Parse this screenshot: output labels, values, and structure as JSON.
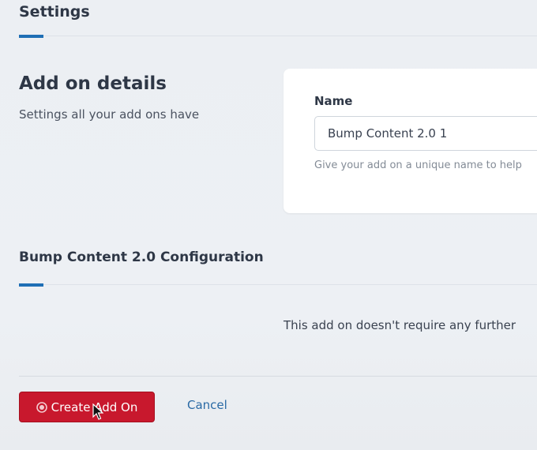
{
  "header": {
    "title": "Settings"
  },
  "details": {
    "heading": "Add on details",
    "subtitle": "Settings all your add ons have"
  },
  "name_field": {
    "label": "Name",
    "value": "Bump Content 2.0 1",
    "help": "Give your add on a unique name to help"
  },
  "configuration": {
    "heading": "Bump Content 2.0 Configuration",
    "message": "This add on doesn't require any further"
  },
  "footer": {
    "create_label": "Create Add On",
    "create_icon": "record-icon",
    "cancel_label": "Cancel"
  },
  "colors": {
    "accent": "#1f6fb5",
    "primary_button": "#c8182d",
    "link": "#2a6aa5"
  }
}
